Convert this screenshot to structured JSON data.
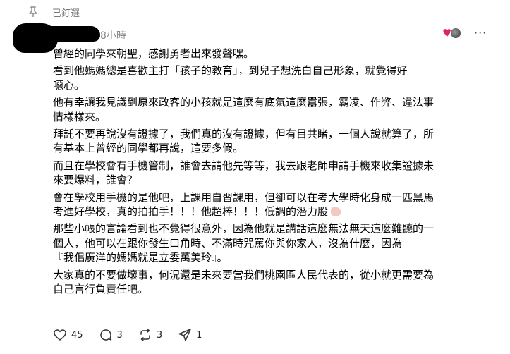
{
  "pinned": {
    "label": "已釘選"
  },
  "post": {
    "time": "8小時",
    "lines": [
      [
        "曾經的同學來朝聖，感謝勇者出來發聲嘿。"
      ],
      [
        "看到他媽媽總是喜歡主打「孩子的教育」，到兒子想洗白自己形象，就覺得好",
        "噁心。"
      ],
      [
        "他有幸讓我見識到原來政客的小孩就是這麼有底氣這麼囂張，霸凌、作弊、違法事",
        "情樣樣來。"
      ],
      [
        "拜託不要再說沒有證據了，我們真的沒有證據，但有目共睹，一個人說就算了，所",
        "有基本上曾經的同學都再說，這要多假。"
      ],
      [
        "而且在學校會有手機管制，誰會去請他先等等，我去跟老師申請手機來收集證據未",
        "來要爆料，誰會？"
      ],
      [
        "會在學校用手機的是他吧，上課用自習課用，但卻可以在考大學時化身成一匹黑馬",
        "考進好學校，真的拍拍手！！！他超棒！！！低調的潛力股"
      ],
      [
        "那些小帳的言論看到也不覺得很意外，因為他就是講話這麼無法無天這麼難聽的一",
        "個人，他可以在跟你發生口角時、不滿時咒罵你與你家人，沒為什麼，因為",
        "『我佀廣洋的媽媽就是立委萬美玲』。"
      ],
      [
        "大家真的不要做壞事，何況還是未來要當我們桃園區人民代表的，從小就更需要為",
        "自己言行負責任吧。"
      ]
    ]
  },
  "actions": {
    "likes": "45",
    "comments": "3",
    "reposts": "3",
    "shares": "1"
  }
}
